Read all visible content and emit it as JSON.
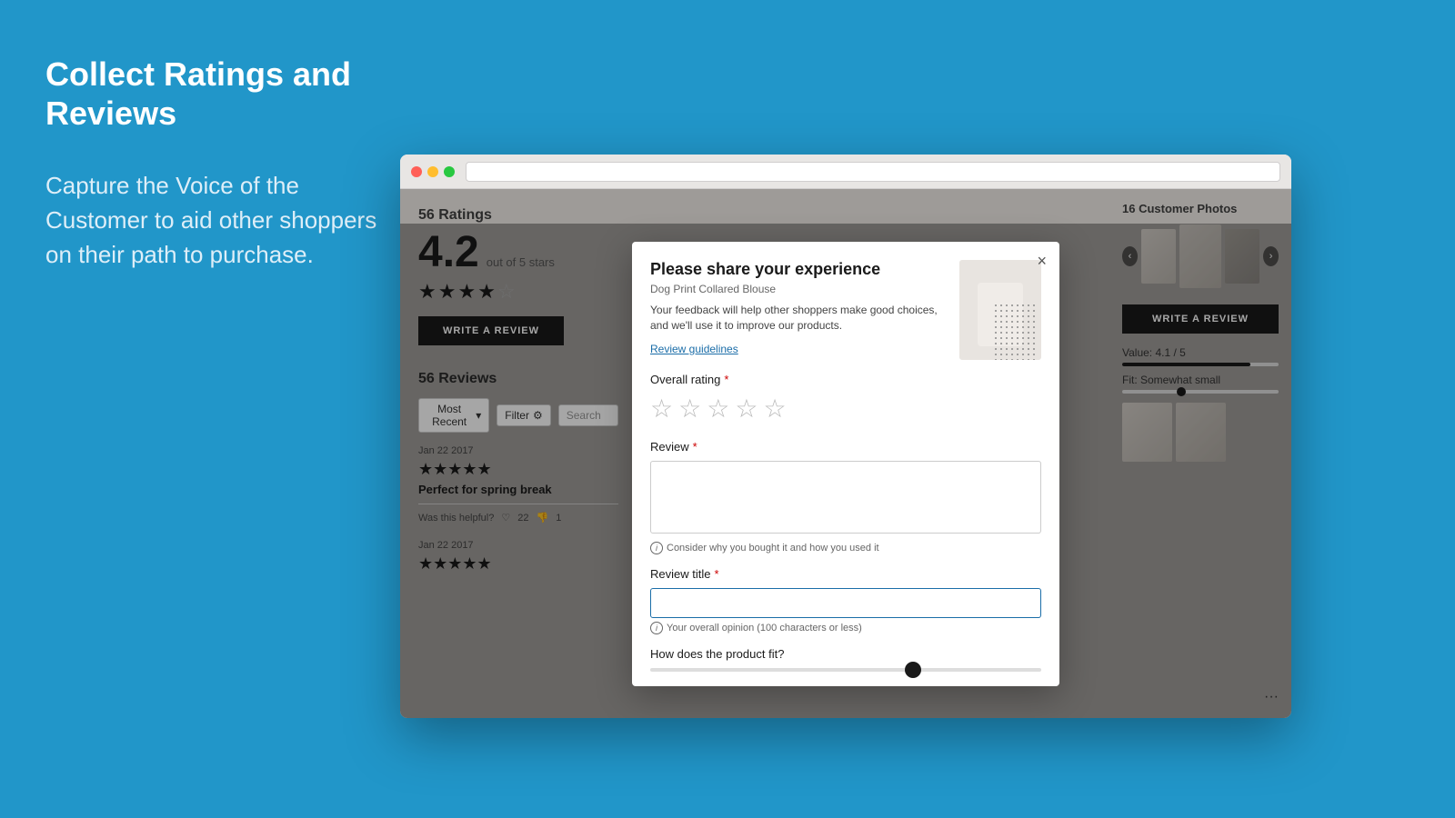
{
  "page": {
    "background_color": "#2196c9"
  },
  "left_panel": {
    "heading": "Collect Ratings and Reviews",
    "subtext": "Capture the Voice of the Customer to aid other shoppers on their path to purchase."
  },
  "browser": {
    "address_bar_placeholder": ""
  },
  "product_page": {
    "ratings_count": "56 Ratings",
    "rating_number": "4.2",
    "rating_out_of": "out of 5 stars",
    "write_review_btn": "WRITE A REVIEW",
    "reviews_title": "56 Reviews",
    "filter_label": "Most Recent",
    "filter_btn": "Filter",
    "search_placeholder": "Search",
    "reviews": [
      {
        "date": "Jan 22 2017",
        "stars": "★★★★★",
        "title": "Perfect for spring break",
        "helpful_label": "Was this helpful?",
        "likes": "22",
        "dislikes": "1"
      },
      {
        "date": "Jan 22 2017",
        "stars": "★★★★★"
      }
    ],
    "photos_title": "16 Customer Photos",
    "write_review_btn_right": "WRITE A REVIEW",
    "value_label": "Value: 4.1 / 5",
    "fit_label": "Fit: Somewhat small"
  },
  "modal": {
    "close_btn": "×",
    "title": "Please share your experience",
    "product_name": "Dog Print Collared Blouse",
    "description": "Your feedback will help other shoppers make good choices, and we'll use it to improve our products.",
    "guidelines_link": "Review guidelines",
    "overall_rating_label": "Overall rating",
    "required_marker": "*",
    "review_label": "Review",
    "review_hint": "Consider why you bought it and how you used it",
    "review_title_label": "Review title",
    "review_title_hint": "Your overall opinion (100 characters or less)",
    "fit_label": "How does the product fit?",
    "stars": [
      "☆",
      "☆",
      "☆",
      "☆",
      "☆"
    ]
  }
}
